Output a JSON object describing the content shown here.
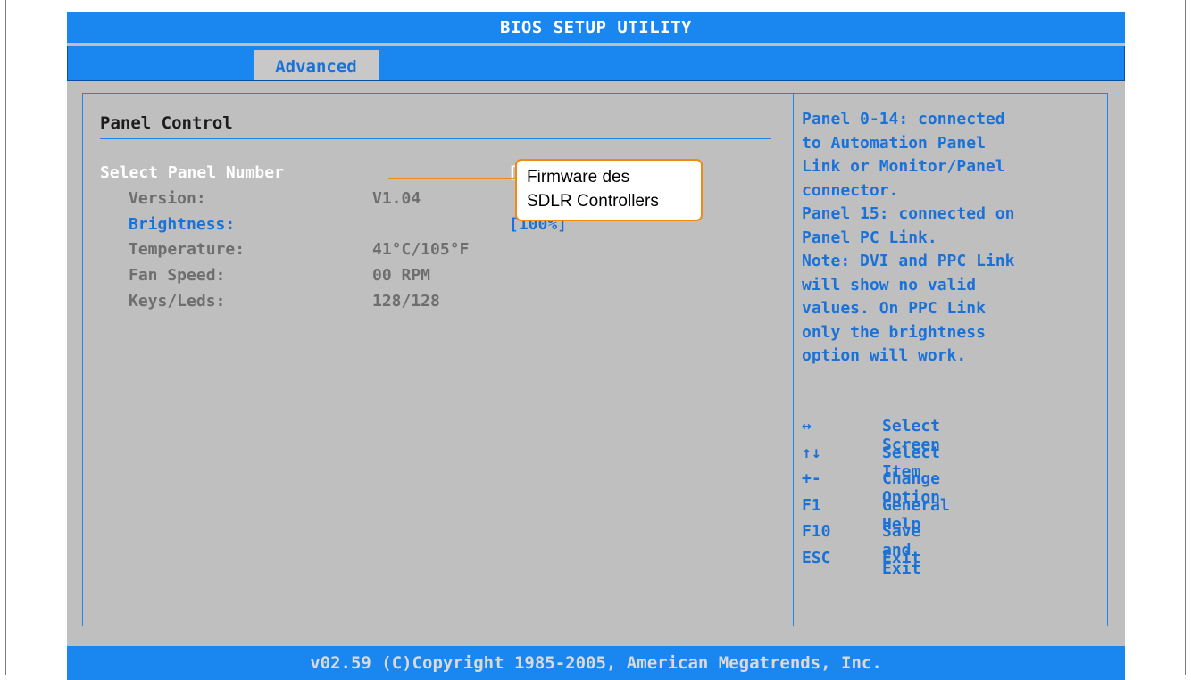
{
  "title": "BIOS SETUP UTILITY",
  "tabs": [
    {
      "label": "Advanced"
    }
  ],
  "main": {
    "section_title": "Panel Control",
    "rows": [
      {
        "label": "Select Panel Number",
        "value": "[0]"
      },
      {
        "label": "Version:",
        "value": "V1.04"
      },
      {
        "label": "Brightness:",
        "value": "[100%]"
      },
      {
        "label": "Temperature:",
        "value": "41°C/105°F"
      },
      {
        "label": "Fan Speed:",
        "value": "00 RPM"
      },
      {
        "label": "Keys/Leds:",
        "value": "128/128"
      }
    ]
  },
  "help": {
    "lines": [
      "Panel 0-14: connected",
      "to Automation Panel",
      "Link or Monitor/Panel",
      "connector.",
      "Panel 15: connected on",
      "Panel PC Link.",
      "Note: DVI and PPC Link",
      "will show no valid",
      "values. On PPC Link",
      "only the brightness",
      "option will work."
    ],
    "keys": [
      {
        "key": "↔",
        "desc": "Select Screen"
      },
      {
        "key": "↑↓",
        "desc": "Select Item"
      },
      {
        "key": "+-",
        "desc": "Change Option"
      },
      {
        "key": "F1",
        "desc": "General Help"
      },
      {
        "key": "F10",
        "desc": "Save and Exit"
      },
      {
        "key": "ESC",
        "desc": "Exit"
      }
    ]
  },
  "footer": "v02.59 (C)Copyright 1985-2005, American Megatrends, Inc.",
  "callout": {
    "line1": "Firmware des",
    "line2": "SDLR Controllers"
  },
  "colors": {
    "bios_blue": "#1a86f0",
    "panel_grey": "#bfbfbf",
    "callout_orange": "#f08a14"
  }
}
